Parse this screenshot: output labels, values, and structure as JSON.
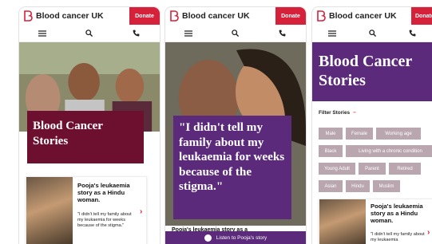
{
  "brand": {
    "name": "Blood cancer UK",
    "donate_label": "Donate",
    "accent": "#d6213a",
    "purple": "#5b2a7a",
    "maroon": "#6d1030"
  },
  "icons": {
    "menu": "hamburger-menu-icon",
    "search": "search-icon",
    "phone": "phone-icon",
    "chevron": "chevron-right-icon",
    "play": "play-icon"
  },
  "screen1": {
    "hero_title": "Blood Cancer Stories",
    "card": {
      "title": "Pooja's leukaemia story as a Hindu woman.",
      "body": "\"I didn't tell my family about my leukaemia for weeks because of the stigma.\""
    }
  },
  "screen2": {
    "quote": "\"I didn't tell my family about my leukaemia for weeks because of the stigma.\"",
    "footer_title": "Pooja's leukaemia story as a",
    "listen_label": "Listen to Pooja's story"
  },
  "screen3": {
    "hero_title_line1": "Blood Cancer",
    "hero_title_line2": "Stories",
    "filter_label": "Filter Stories",
    "filter_toggle": "−",
    "tags": [
      "Male",
      "Female",
      "Working age",
      "Black",
      "Living with a chronic condition",
      "Young Adult",
      "Parent",
      "Retired",
      "Asian",
      "Hindu",
      "Muslim"
    ],
    "card": {
      "title": "Pooja's leukaemia story as a Hindu woman.",
      "body": "\"I didn't tell my family about my leukaemia"
    }
  }
}
